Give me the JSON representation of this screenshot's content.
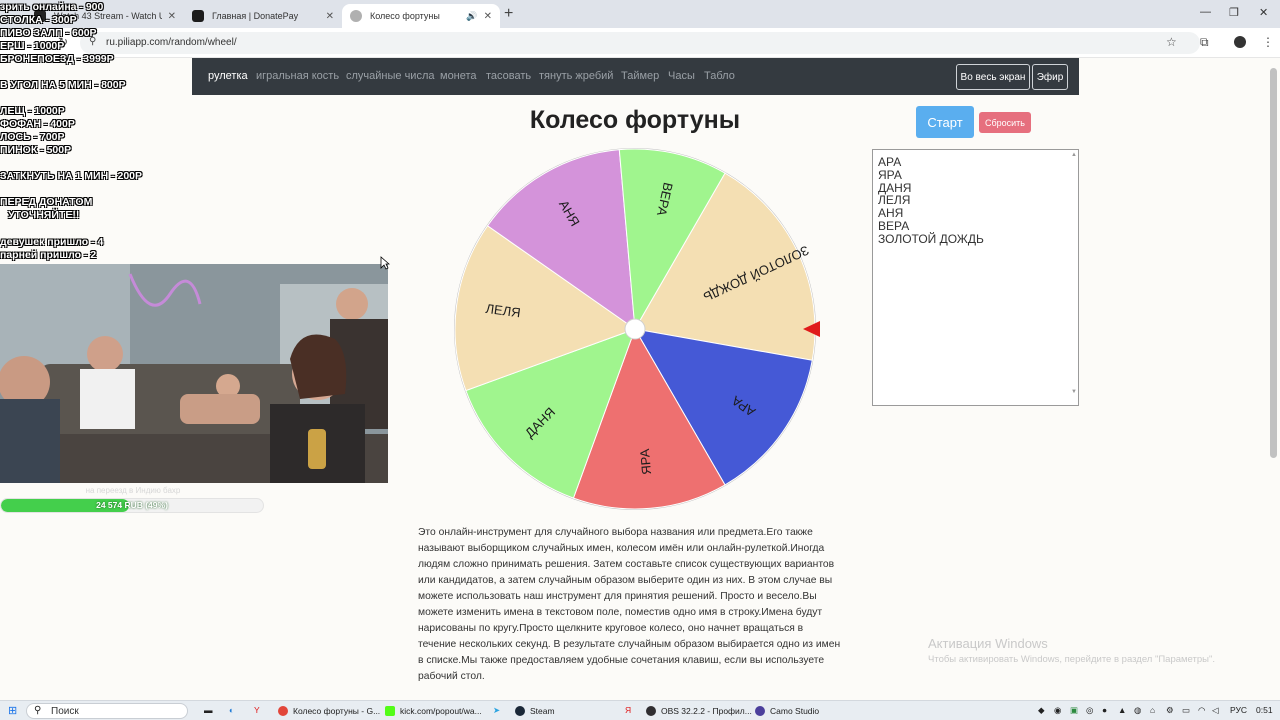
{
  "browser": {
    "tabs": [
      {
        "title": "Watch 43 Stream - Watch Us",
        "favicon_color": "#222222"
      },
      {
        "title": "Главная | DonatePay",
        "favicon_color": "#1c1c1c"
      },
      {
        "title": "Колесо фортуны",
        "favicon_color": "#b0b0b0",
        "active": true
      }
    ],
    "url": "ru.piliapp.com/random/wheel/"
  },
  "navbar": {
    "links": [
      "рулетка",
      "игральная кость",
      "случайные числа",
      "монета",
      "тасовать",
      "тянуть жребий",
      "Таймер",
      "Часы",
      "Табло"
    ],
    "fullscreen_label": "Во весь экран",
    "broadcast_label": "Эфир"
  },
  "main": {
    "title": "Колесо фортуны",
    "start_label": "Старт",
    "reset_label": "Сбросить",
    "names": [
      "АРА",
      "ЯРА",
      "ДАНЯ",
      "ЛЕЛЯ",
      "АНЯ",
      "ВЕРА",
      "ЗОЛОТОЙ ДОЖДЬ"
    ],
    "description": "Это онлайн-инструмент для случайного выбора названия или предмета.Его также называют выборщиком случайных имен, колесом имён или онлайн-рулеткой.Иногда людям сложно принимать решения. Затем составьте список существующих вариантов или кандидатов, а затем случайным образом выберите один из них. В этом случае вы можете использовать наш инструмент для принятия решений. Просто и весело.Вы можете изменить имена в текстовом поле, поместив одно имя в строку.Имена будут нарисованы по кругу.Просто щелкните круговое колесо, оно начнет вращаться в течение нескольких секунд. В результате случайным образом выбирается одно из имен в списке.Мы также предоставляем удобные сочетания клавиш, если вы используете рабочий стол."
  },
  "wheel": {
    "segments": [
      {
        "label": "ЗОЛОТОЙ ДОЖДЬ",
        "color": "#f4dfb3",
        "start": -60,
        "end": 10
      },
      {
        "label": "АРА",
        "color": "#4559d6",
        "start": 10,
        "end": 60
      },
      {
        "label": "ЯРА",
        "color": "#ee7070",
        "start": 60,
        "end": 110
      },
      {
        "label": "ДАНЯ",
        "color": "#a0f58e",
        "start": 110,
        "end": 160
      },
      {
        "label": "ЛЕЛЯ",
        "color": "#f4dfb3",
        "start": 160,
        "end": 215
      },
      {
        "label": "АНЯ",
        "color": "#d493da",
        "start": 215,
        "end": 265
      },
      {
        "label": "ВЕРА",
        "color": "#a0f58e",
        "start": 265,
        "end": 300
      }
    ],
    "pointer_color": "#e01b1b"
  },
  "overlay": {
    "lines": [
      {
        "text": "зрить онлайна - 900"
      },
      {
        "text": "СТОЛКА - 300Р"
      },
      {
        "text": "ПИВО ЗАЛП - 600Р"
      },
      {
        "text": "ЕРШ - 1000Р"
      },
      {
        "text": "БРОНЕПОЕЗД - 3999Р"
      },
      {
        "text": "В УГОЛ НА 5 МИН - 800Р"
      },
      {
        "text": "ЛЕЩ - 1000Р"
      },
      {
        "text": "ФОФАН - 400Р"
      },
      {
        "text": "ЛОСЬ - 700Р"
      },
      {
        "text": "ПИНОК - 500Р"
      },
      {
        "text": "ЗАТКНУТЬ НА 1 МИН - 200Р"
      },
      {
        "text": "ПЕРЕД ДОНАТОМ"
      },
      {
        "text": "УТОЧНЯЙТЕ!!"
      },
      {
        "text": "девушек пришло - 4"
      },
      {
        "text": "парней пришло - 2"
      }
    ],
    "goal_label": "на переезд в Индию бахр",
    "goal_text": "24 574 RUB (49%)",
    "goal_fraction": 0.49
  },
  "windows": {
    "activation_title": "Активация Windows",
    "activation_sub": "Чтобы активировать Windows, перейдите в раздел \"Параметры\"."
  },
  "taskbar": {
    "search_placeholder": "Поиск",
    "apps": [
      {
        "label": "Колесо фортуны - G...",
        "color": "#e2463a"
      },
      {
        "label": "kick.com/popout/wa...",
        "color": "#53fc18"
      },
      {
        "label": "Steam",
        "color": "#1b2838"
      },
      {
        "label": "OBS 32.2.2 - Профил...",
        "color": "#302e31"
      },
      {
        "label": "Camo Studio",
        "color": "#4b3f9c"
      }
    ],
    "lang": "РУС",
    "time": "0:51"
  }
}
